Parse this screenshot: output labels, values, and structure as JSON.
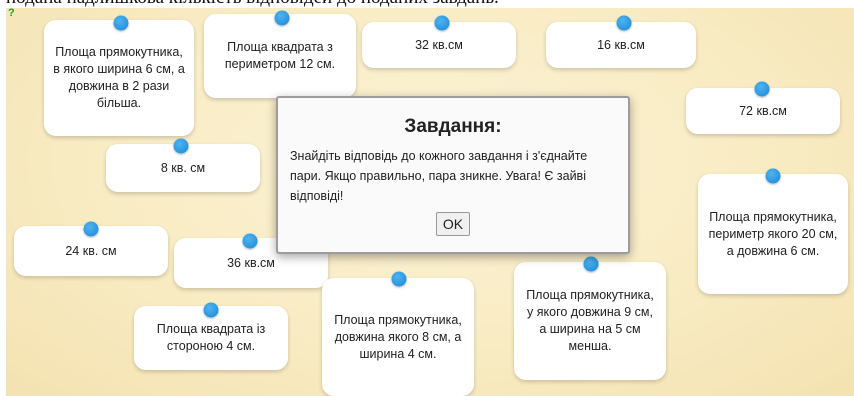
{
  "header": {
    "instruction_text": "подана надлишкова кількість відповідей до поданих завдань."
  },
  "help_icon": "?",
  "cards": [
    {
      "text": "Площа прямокутника, в якого ширина 6 см, а довжина в 2 рази більша."
    },
    {
      "text": "Площа квадрата з периметром 12 см."
    },
    {
      "text": "32 кв.см"
    },
    {
      "text": "16 кв.см"
    },
    {
      "text": "72 кв.см"
    },
    {
      "text": "8 кв. см"
    },
    {
      "text": "Площа прямокутника, периметр якого 20 см, а довжина 6 см."
    },
    {
      "text": "24 кв. см"
    },
    {
      "text": "36 кв.см"
    },
    {
      "text": "Площа прямокутника, довжина якого 8 см, а ширина 4 см."
    },
    {
      "text": "Площа прямокутника, у якого довжина 9 см, а ширина на 5 см менша."
    },
    {
      "text": "Площа квадрата із стороною 4 см."
    }
  ],
  "modal": {
    "title": "Завдання:",
    "text": "Знайдіть відповідь до кожного завдання і з'єднайте пари. Якщо правильно, пара зникне. Увага! Є зайві відповіді!",
    "ok_label": "OK"
  },
  "colors": {
    "pin": "#1787d6",
    "board": "#f8ebc2",
    "card": "#ffffff"
  }
}
